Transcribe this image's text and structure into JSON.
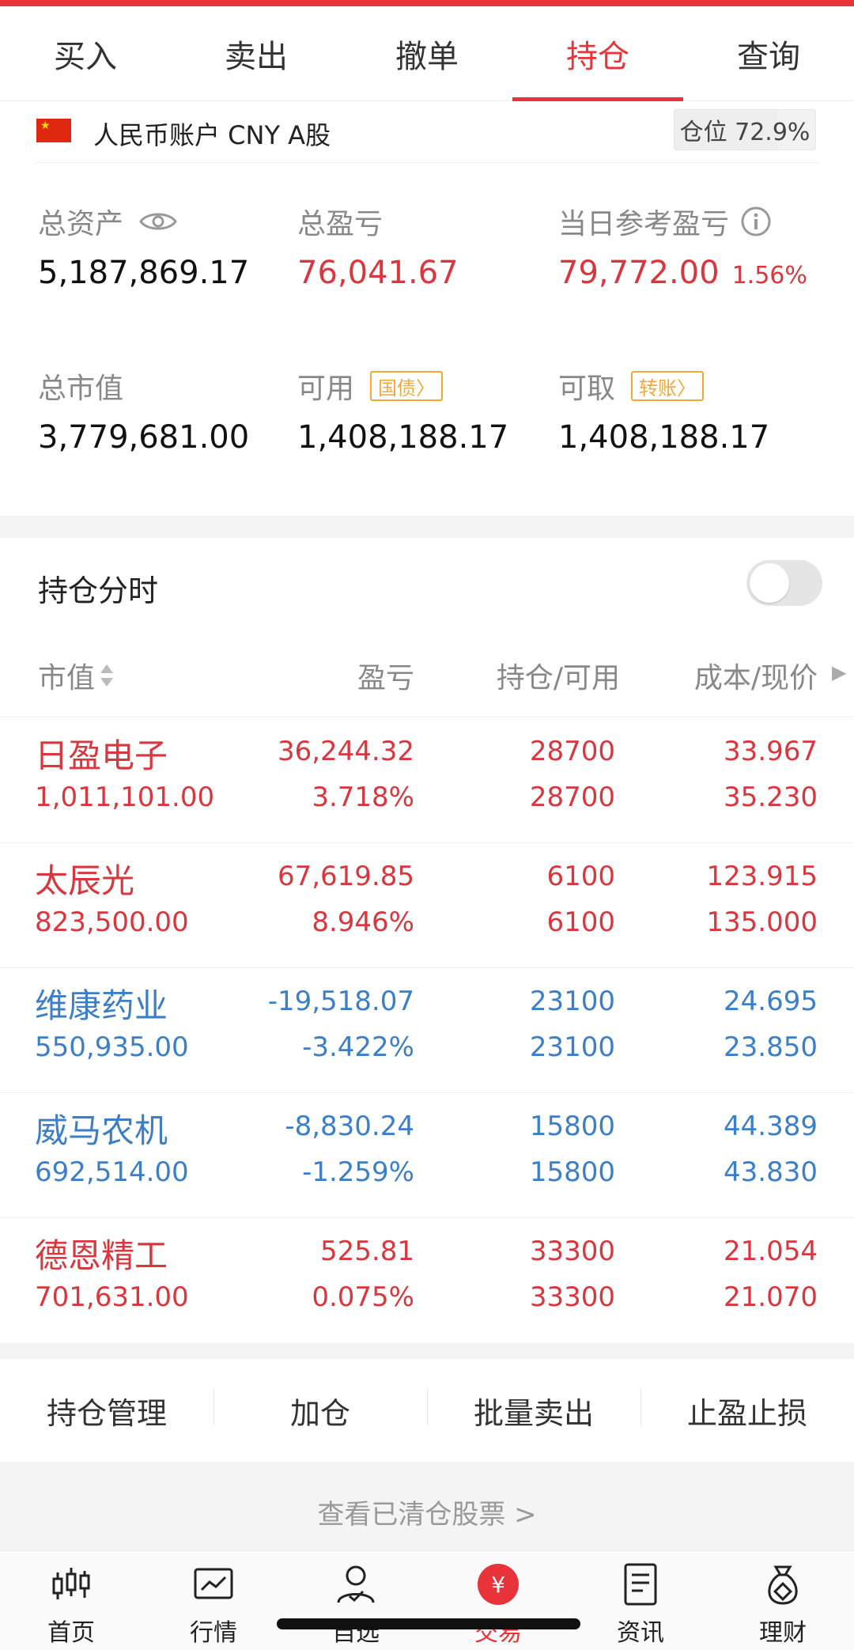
{
  "tabs": [
    {
      "label": "买入",
      "active": false
    },
    {
      "label": "卖出",
      "active": false
    },
    {
      "label": "撤单",
      "active": false
    },
    {
      "label": "持仓",
      "active": true
    },
    {
      "label": "查询",
      "active": false
    }
  ],
  "account": {
    "label": "人民币账户 CNY A股",
    "position_text": "仓位 72.9%",
    "position_ratio": 0.729
  },
  "summary": {
    "total_assets_label": "总资产",
    "total_assets": "5,187,869.17",
    "total_pl_label": "总盈亏",
    "total_pl": "76,041.67",
    "day_pl_label": "当日参考盈亏",
    "day_pl": "79,772.00",
    "day_pl_pct": "1.56%",
    "market_value_label": "总市值",
    "market_value": "3,779,681.00",
    "available_label": "可用",
    "available_tag": "国债",
    "available": "1,408,188.17",
    "withdrawable_label": "可取",
    "withdrawable_tag": "转账",
    "withdrawable": "1,408,188.17"
  },
  "holdings": {
    "title": "持仓分时",
    "toggle_on": false,
    "headers": {
      "market_value": "市值",
      "pl": "盈亏",
      "qty": "持仓/可用",
      "price": "成本/现价"
    },
    "rows": [
      {
        "name": "日盈电子",
        "market_value": "1,011,101.00",
        "pl": "36,244.32",
        "pl_pct": "3.718%",
        "position": "28700",
        "available": "28700",
        "cost": "33.967",
        "price": "35.230",
        "trend": "up"
      },
      {
        "name": "太辰光",
        "market_value": "823,500.00",
        "pl": "67,619.85",
        "pl_pct": "8.946%",
        "position": "6100",
        "available": "6100",
        "cost": "123.915",
        "price": "135.000",
        "trend": "up"
      },
      {
        "name": "维康药业",
        "market_value": "550,935.00",
        "pl": "-19,518.07",
        "pl_pct": "-3.422%",
        "position": "23100",
        "available": "23100",
        "cost": "24.695",
        "price": "23.850",
        "trend": "down"
      },
      {
        "name": "威马农机",
        "market_value": "692,514.00",
        "pl": "-8,830.24",
        "pl_pct": "-1.259%",
        "position": "15800",
        "available": "15800",
        "cost": "44.389",
        "price": "43.830",
        "trend": "down"
      },
      {
        "name": "德恩精工",
        "market_value": "701,631.00",
        "pl": "525.81",
        "pl_pct": "0.075%",
        "position": "33300",
        "available": "33300",
        "cost": "21.054",
        "price": "21.070",
        "trend": "up"
      }
    ]
  },
  "actions": [
    "持仓管理",
    "加仓",
    "批量卖出",
    "止盈止损"
  ],
  "cleared_link": "查看已清仓股票 >",
  "bottom_nav": [
    {
      "label": "首页",
      "icon": "candlestick-icon",
      "active": false
    },
    {
      "label": "行情",
      "icon": "chart-icon",
      "active": false
    },
    {
      "label": "自选",
      "icon": "user-check-icon",
      "active": false
    },
    {
      "label": "交易",
      "icon": "yuan-icon",
      "active": true
    },
    {
      "label": "资讯",
      "icon": "document-icon",
      "active": false
    },
    {
      "label": "理财",
      "icon": "money-bag-icon",
      "active": false
    }
  ],
  "colors": {
    "up": "#d9363e",
    "down": "#3c7fc6",
    "accent": "#e8333a",
    "tag": "#f0a93a"
  }
}
